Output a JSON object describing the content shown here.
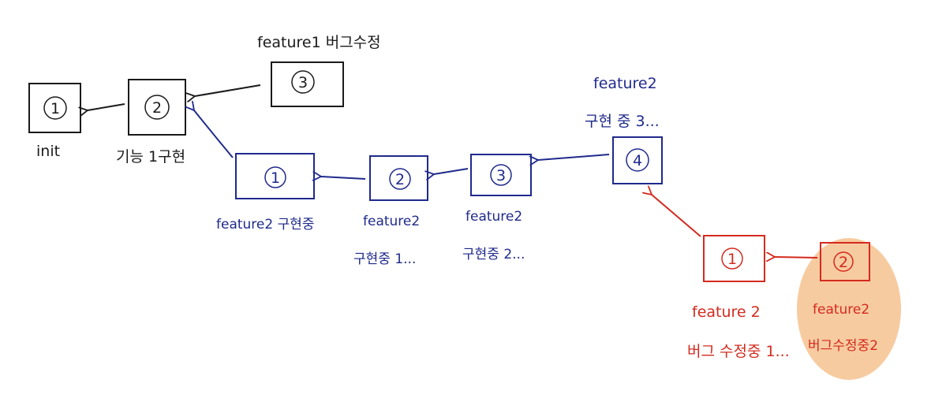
{
  "colors": {
    "black": "#1a1a1a",
    "blue": "#1f2a8c",
    "red": "#d42a1e",
    "highlight": "#f6c596"
  },
  "main": {
    "c1": {
      "num": "1",
      "label": "init"
    },
    "c2": {
      "num": "2",
      "label": "기능 1구현"
    },
    "c3": {
      "num": "3",
      "label": "feature1 버그수정"
    }
  },
  "feature2": {
    "c1": {
      "num": "1",
      "label": "feature2 구현중"
    },
    "c2": {
      "num": "2",
      "label_line1": "feature2",
      "label_line2": "구현중 1..."
    },
    "c3": {
      "num": "3",
      "label_line1": "feature2",
      "label_line2": "구현중 2..."
    },
    "c4": {
      "num": "4",
      "label_line1": "feature2",
      "label_line2": "구현 중 3..."
    }
  },
  "bugfix": {
    "c1": {
      "num": "1",
      "label_line1": "feature 2",
      "label_line2": "버그 수정중 1..."
    },
    "c2": {
      "num": "2",
      "label_line1": "feature2",
      "label_line2": "버그수정중2"
    }
  }
}
